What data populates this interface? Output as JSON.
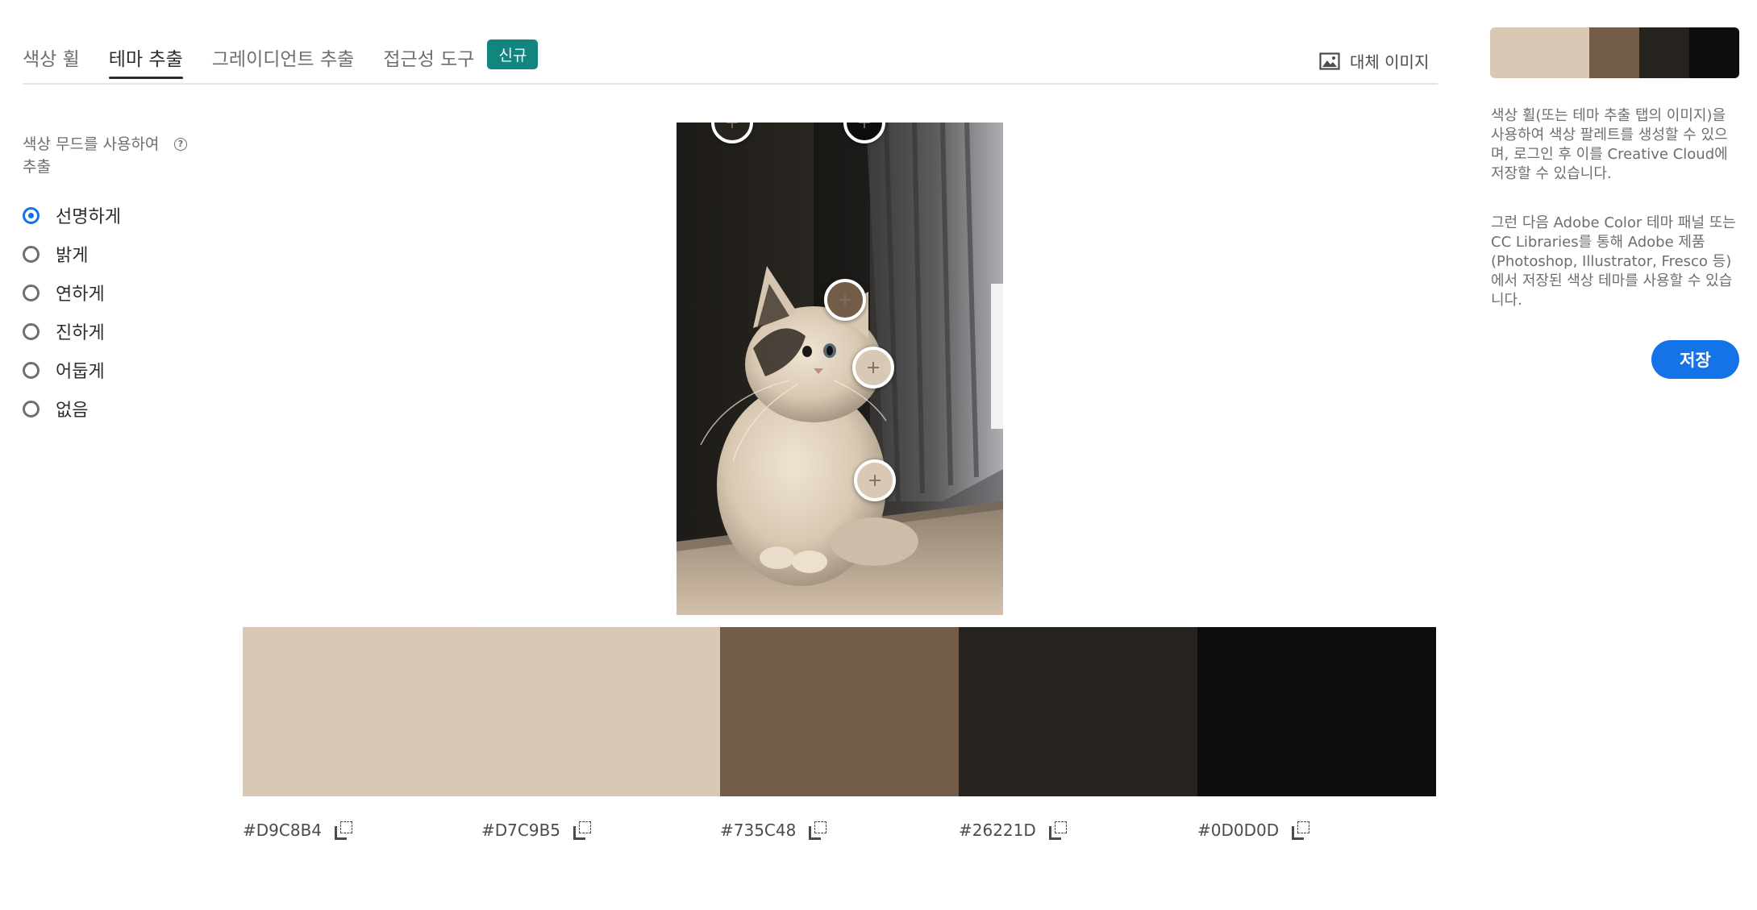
{
  "tabs": [
    {
      "label": "색상 휠",
      "active": false
    },
    {
      "label": "테마 추출",
      "active": true
    },
    {
      "label": "그레이디언트 추출",
      "active": false
    },
    {
      "label": "접근성 도구",
      "active": false
    }
  ],
  "badge": "신규",
  "alt_image_label": "대체 이미지",
  "mood": {
    "title": "색상 무드를 사용하여 추출",
    "options": [
      "선명하게",
      "밝게",
      "연하게",
      "진하게",
      "어둡게",
      "없음"
    ],
    "selected": "선명하게"
  },
  "palette": [
    {
      "hex": "#D9C8B4",
      "color": "#d9c8b4"
    },
    {
      "hex": "#D7C9B5",
      "color": "#d7c9b5"
    },
    {
      "hex": "#735C48",
      "color": "#735c48"
    },
    {
      "hex": "#26221D",
      "color": "#26221d"
    },
    {
      "hex": "#0D0D0D",
      "color": "#0d0d0d"
    }
  ],
  "description": {
    "p1": "색상 휠(또는 테마 추출 탭의 이미지)을 사용하여 색상 팔레트를 생성할 수 있으며, 로그인 후 이를 Creative Cloud에 저장할 수 있습니다.",
    "p2": "그런 다음 Adobe Color 테마 패널 또는 CC Libraries를 통해 Adobe 제품(Photoshop, Illustrator, Fresco 등)에서 저장된 색상 테마를 사용할 수 있습니다."
  },
  "save_label": "저장",
  "icons": {
    "image": "image-icon",
    "help": "help-circle-icon",
    "copy": "copy-icon",
    "picker": "color-picker-handle"
  }
}
